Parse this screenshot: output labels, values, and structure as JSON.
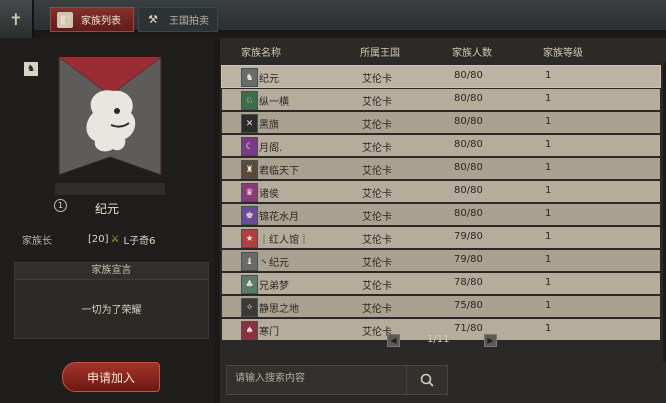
{
  "tabs": [
    {
      "label": "家族列表"
    },
    {
      "label": "王国拍卖"
    }
  ],
  "family": {
    "rank": "1",
    "name": "纪元",
    "leader_label": "家族长",
    "leader_level": "[20]",
    "leader_name": "L子奇6",
    "declaration_title": "家族宣言",
    "declaration": "一切为了荣耀"
  },
  "apply_button": "申请加入",
  "table": {
    "headers": [
      "家族名称",
      "所属王国",
      "家族人数",
      "家族等级"
    ],
    "rows": [
      {
        "name": "纪元",
        "kingdom": "艾伦卡",
        "members": "80/80",
        "level": "1"
      },
      {
        "name": "纵一横",
        "kingdom": "艾伦卡",
        "members": "80/80",
        "level": "1"
      },
      {
        "name": "黑旗",
        "kingdom": "艾伦卡",
        "members": "80/80",
        "level": "1"
      },
      {
        "name": "月阁.",
        "kingdom": "艾伦卡",
        "members": "80/80",
        "level": "1"
      },
      {
        "name": "君临天下",
        "kingdom": "艾伦卡",
        "members": "80/80",
        "level": "1"
      },
      {
        "name": "诸侯",
        "kingdom": "艾伦卡",
        "members": "80/80",
        "level": "1"
      },
      {
        "name": "锦花水月",
        "kingdom": "艾伦卡",
        "members": "80/80",
        "level": "1"
      },
      {
        "name": "｜红人馆｜",
        "kingdom": "艾伦卡",
        "members": "79/80",
        "level": "1"
      },
      {
        "name": "丶纪元",
        "kingdom": "艾伦卡",
        "members": "79/80",
        "level": "1"
      },
      {
        "name": "兄弟梦",
        "kingdom": "艾伦卡",
        "members": "78/80",
        "level": "1"
      },
      {
        "name": "静思之地",
        "kingdom": "艾伦卡",
        "members": "75/80",
        "level": "1"
      },
      {
        "name": "寒门",
        "kingdom": "艾伦卡",
        "members": "71/80",
        "level": "1"
      }
    ]
  },
  "pager": {
    "text": "1/11"
  },
  "search": {
    "placeholder": "请输入搜索内容"
  },
  "colors": {
    "accent_red": "#86302c",
    "selected_row": "#bdb3a3"
  }
}
